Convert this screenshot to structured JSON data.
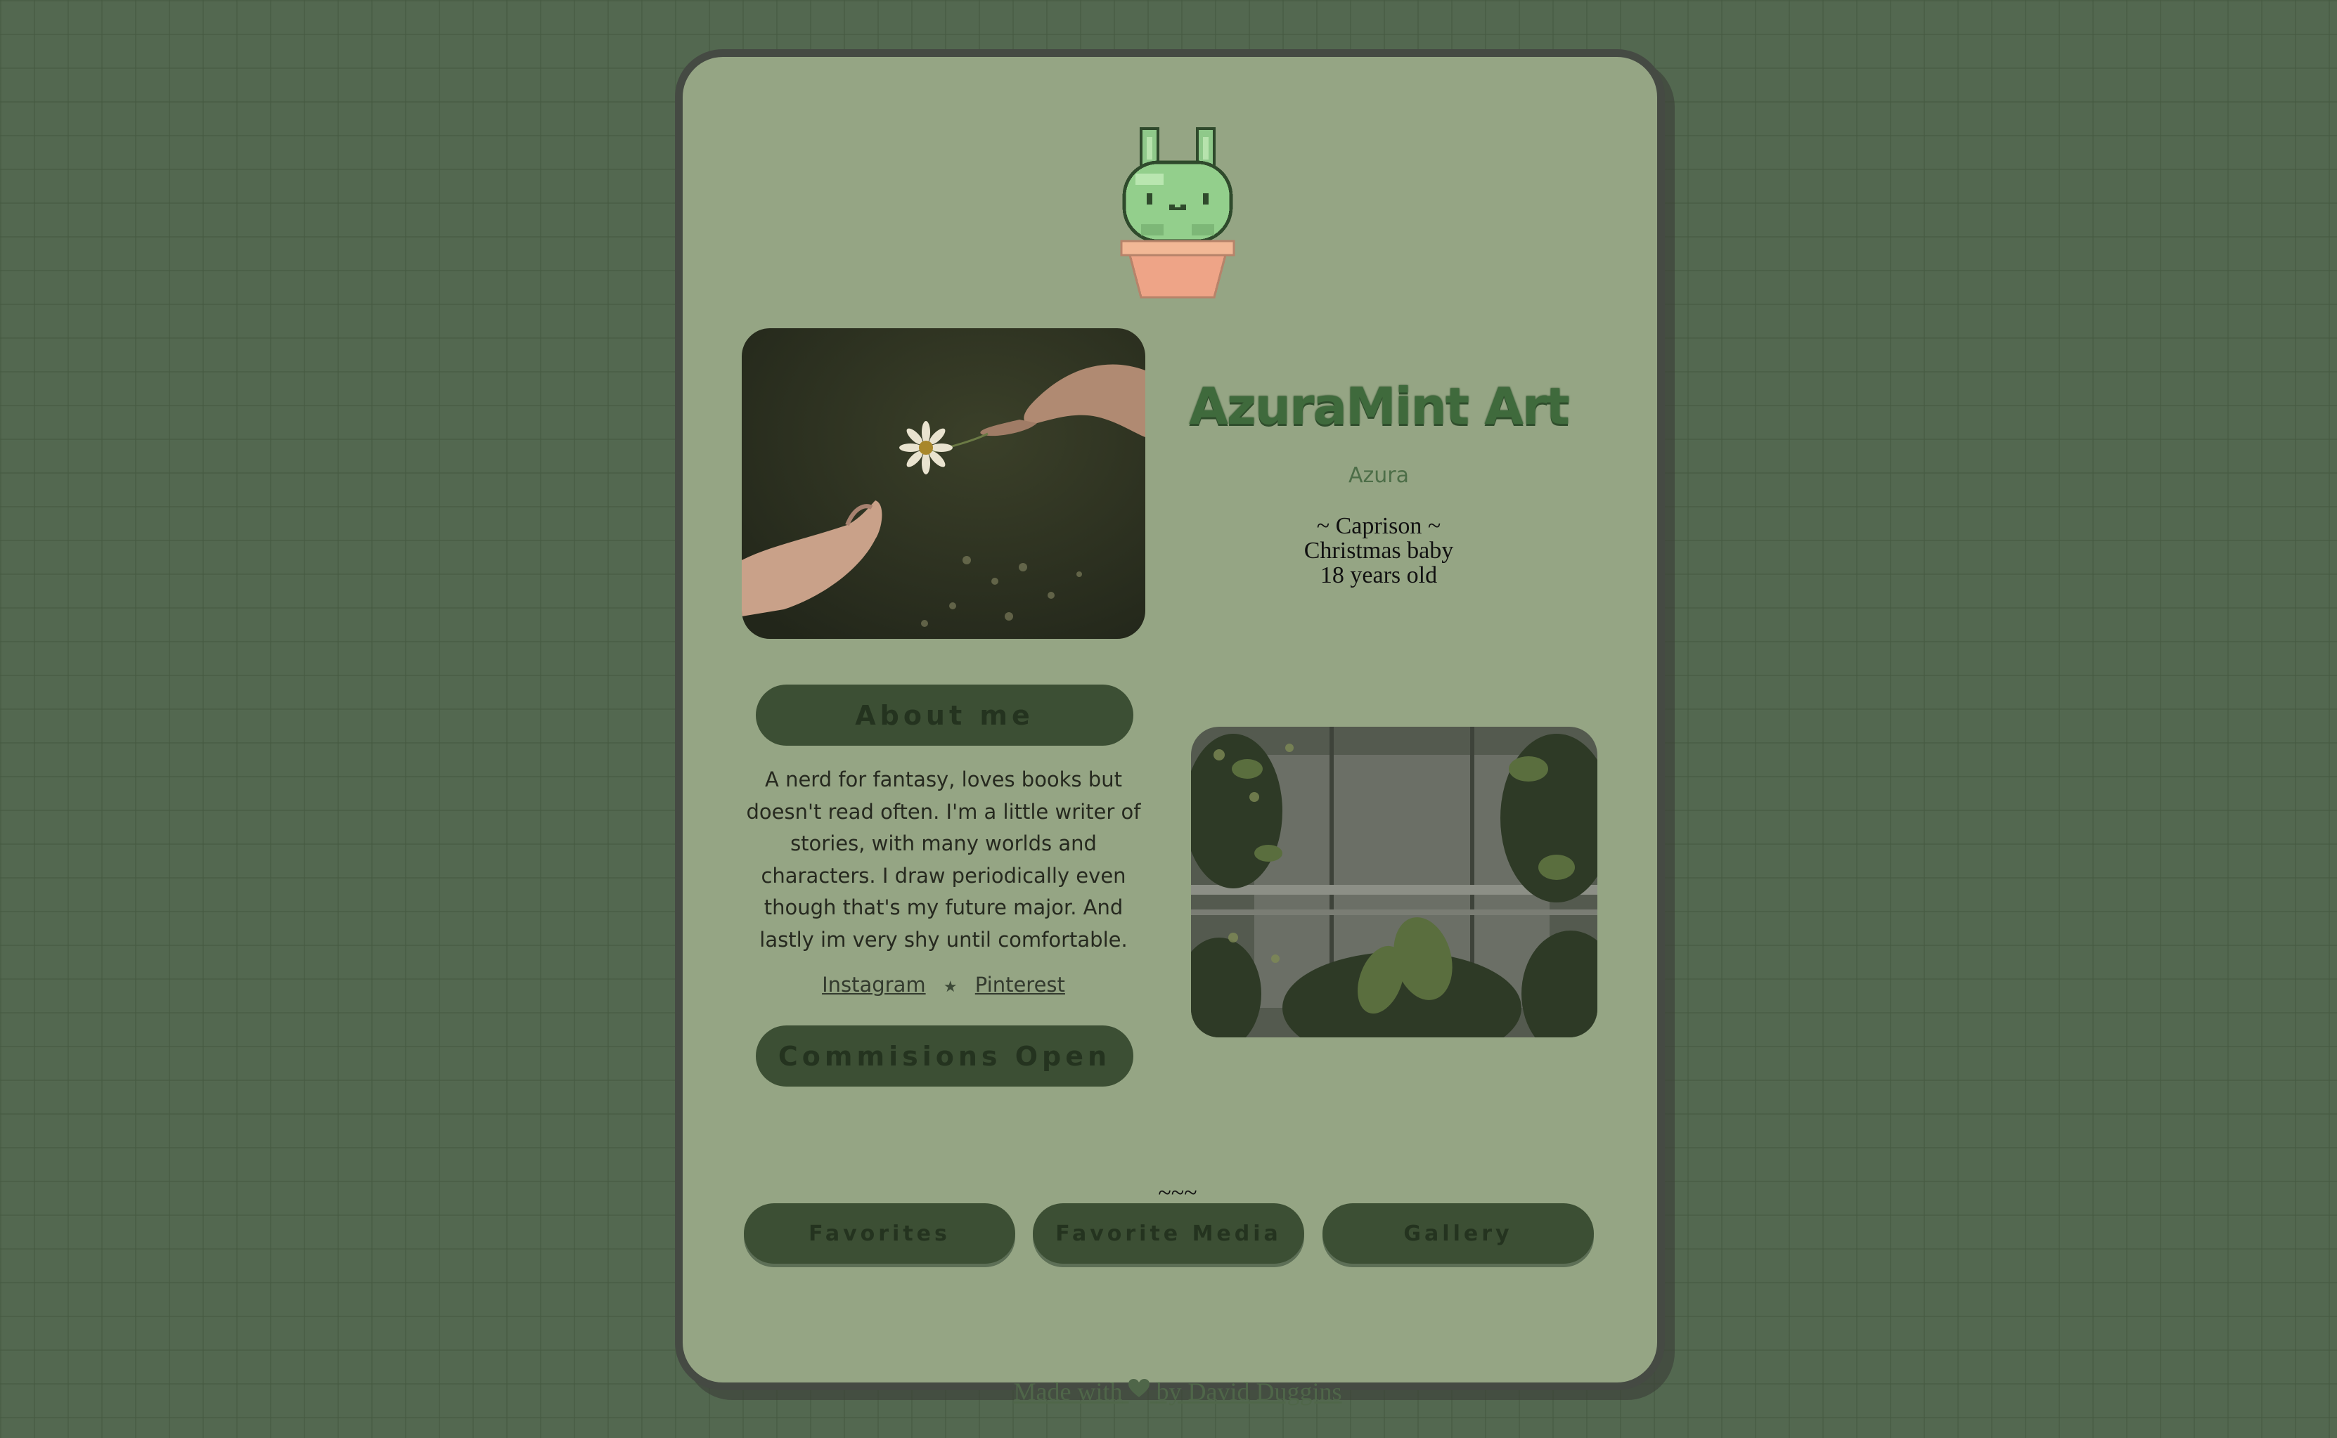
{
  "site": {
    "title": "AzuraMint Art",
    "subtitle": "Azura",
    "bio_lines": [
      "~ Caprison ~",
      "Christmas baby",
      "18 years old"
    ]
  },
  "about": {
    "button_label": "About me",
    "text": "A nerd for fantasy, loves books but doesn't read often. I'm a little writer of stories, with many worlds and characters. I draw periodically even though that's my future major. And lastly im very shy until comfortable."
  },
  "links": {
    "instagram": "Instagram",
    "separator": "★",
    "pinterest": "Pinterest"
  },
  "commissions_label": "Commisions Open",
  "divider": "~~~",
  "nav": {
    "favorites": "Favorites",
    "favorite_media": "Favorite Media",
    "gallery": "Gallery"
  },
  "footer": {
    "made_with": "Made with",
    "by": "by David Duggins"
  },
  "icons": {
    "mascot": "bunny-in-pot-icon",
    "separator": "star-icon",
    "footer": "heart-icon"
  },
  "colors": {
    "background": "#536850",
    "card": "#95a584",
    "card_border": "#454a43",
    "accent_dark": "#3c4f34",
    "title_green": "#3f6a3c"
  }
}
